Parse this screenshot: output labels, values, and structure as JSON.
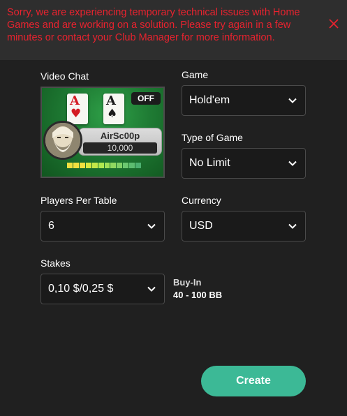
{
  "banner": {
    "message": "Sorry, we are experiencing temporary technical issues with Home Games and are working on a solution. Please try again in a few minutes or contact your Club Manager for more information.",
    "close_icon": "close-icon",
    "color": "#e8232f"
  },
  "video_chat": {
    "label": "Video Chat",
    "status_badge": "OFF",
    "cards": [
      {
        "rank": "A",
        "suit": "♥"
      },
      {
        "rank": "A",
        "suit": "♠"
      }
    ],
    "player_name": "AirSc00p",
    "player_stack": "10,000"
  },
  "game": {
    "label": "Game",
    "value": "Hold'em"
  },
  "type_of_game": {
    "label": "Type of Game",
    "value": "No Limit"
  },
  "players_per_table": {
    "label": "Players Per Table",
    "value": "6"
  },
  "currency": {
    "label": "Currency",
    "value": "USD"
  },
  "stakes": {
    "label": "Stakes",
    "value": "0,10 $/0,25 $"
  },
  "buy_in": {
    "label": "Buy-In",
    "value": "40 - 100 BB"
  },
  "create_button": {
    "label": "Create",
    "color": "#3cb996"
  }
}
